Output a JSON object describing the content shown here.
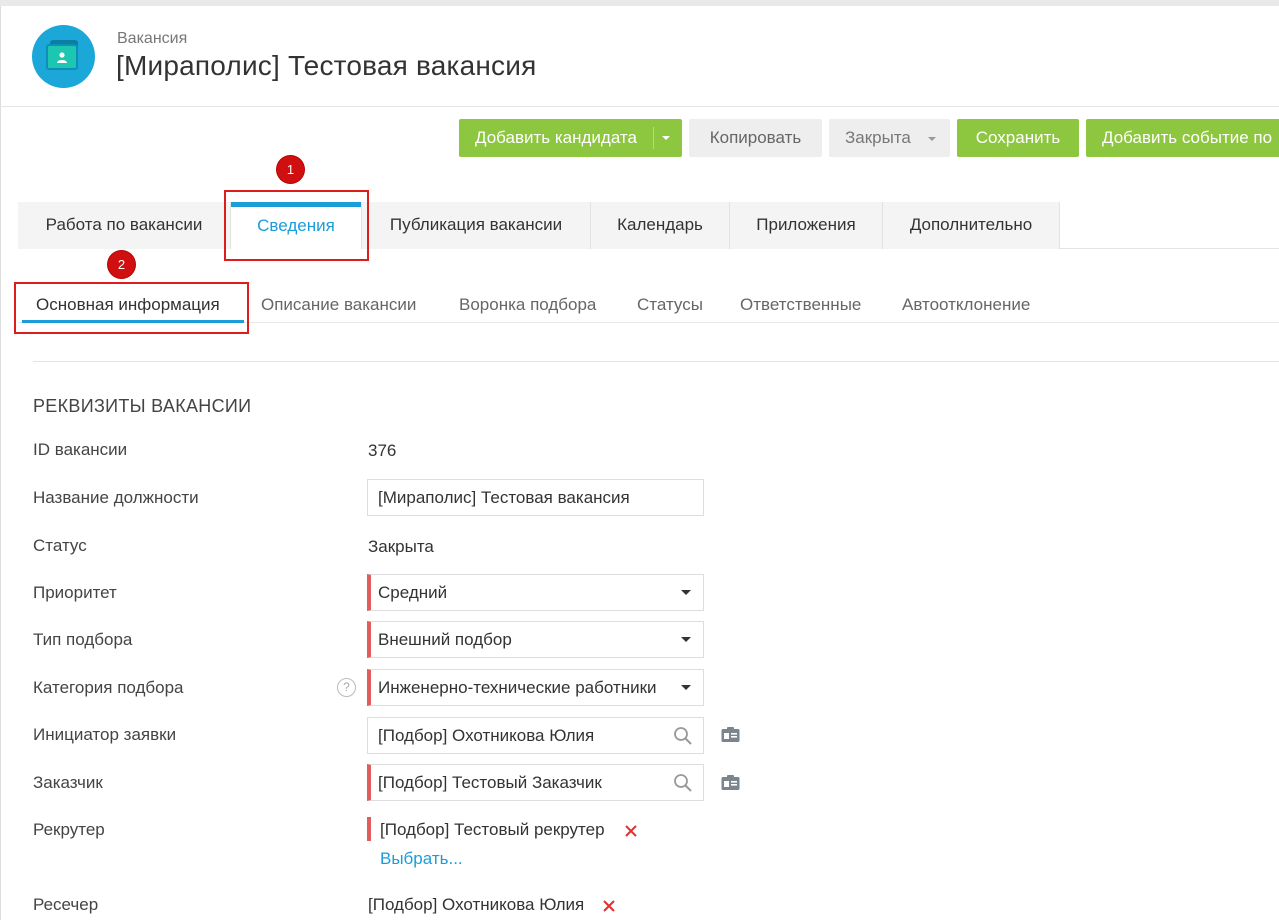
{
  "header": {
    "subtitle": "Вакансия",
    "title": "[Мираполис] Тестовая вакансия"
  },
  "toolbar": {
    "add_candidate": "Добавить кандидата",
    "copy": "Копировать",
    "status": "Закрыта",
    "save": "Сохранить",
    "add_event": "Добавить событие по"
  },
  "annotations": {
    "badge1": "1",
    "badge2": "2"
  },
  "tabs": [
    {
      "label": "Работа по вакансии"
    },
    {
      "label": "Сведения"
    },
    {
      "label": "Публикация вакансии"
    },
    {
      "label": "Календарь"
    },
    {
      "label": "Приложения"
    },
    {
      "label": "Дополнительно"
    }
  ],
  "subtabs": [
    {
      "label": "Основная информация"
    },
    {
      "label": "Описание вакансии"
    },
    {
      "label": "Воронка подбора"
    },
    {
      "label": "Статусы"
    },
    {
      "label": "Ответственные"
    },
    {
      "label": "Автоотклонение"
    }
  ],
  "section": {
    "title": "РЕКВИЗИТЫ ВАКАНСИИ"
  },
  "form": {
    "id": {
      "label": "ID вакансии",
      "value": "376"
    },
    "position": {
      "label": "Название должности",
      "value": "[Мираполис] Тестовая вакансия"
    },
    "status": {
      "label": "Статус",
      "value": "Закрыта"
    },
    "priority": {
      "label": "Приоритет",
      "value": "Средний"
    },
    "selection_type": {
      "label": "Тип подбора",
      "value": "Внешний подбор"
    },
    "category": {
      "label": "Категория подбора",
      "value": "Инженерно-технические работники",
      "help": "?"
    },
    "initiator": {
      "label": "Инициатор заявки",
      "value": "[Подбор] Охотникова Юлия"
    },
    "customer": {
      "label": "Заказчик",
      "value": "[Подбор] Тестовый Заказчик"
    },
    "recruiter": {
      "label": "Рекрутер",
      "value": "[Подбор] Тестовый рекрутер",
      "select_link": "Выбрать..."
    },
    "researcher": {
      "label": "Ресечер",
      "value": "[Подбор] Охотникова Юлия"
    }
  },
  "colors": {
    "accent": "#1a9dd9",
    "green": "#8dc63f",
    "required": "#e25c5c",
    "annotation_red": "#e01b1b"
  }
}
